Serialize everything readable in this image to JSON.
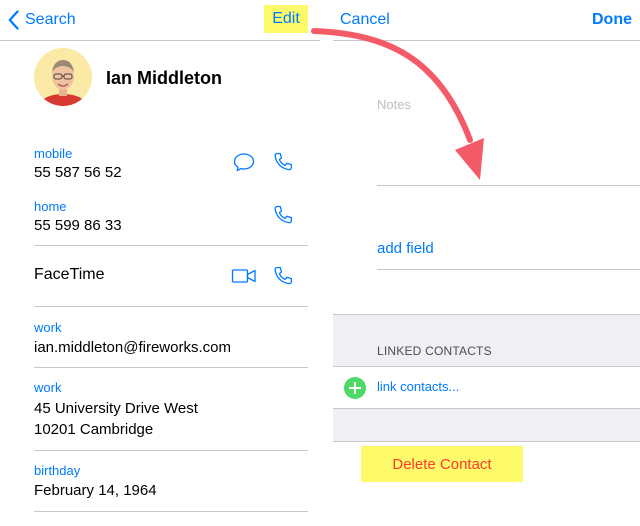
{
  "left": {
    "nav": {
      "back_label": "Search",
      "edit_label": "Edit"
    },
    "contact": {
      "name": "Ian Middleton"
    },
    "fields": {
      "mobile_label": "mobile",
      "mobile_value": "55 587 56 52",
      "home_label": "home",
      "home_value": "55 599 86 33",
      "facetime_label": "FaceTime",
      "work_email_label": "work",
      "work_email_value": "ian.middleton@fireworks.com",
      "work_address_label": "work",
      "work_address_line1": "45 University Drive West",
      "work_address_line2": "10201 Cambridge",
      "birthday_label": "birthday",
      "birthday_value": "February 14, 1964"
    }
  },
  "right": {
    "nav": {
      "cancel_label": "Cancel",
      "done_label": "Done"
    },
    "notes_placeholder": "Notes",
    "add_field_label": "add field",
    "linked_contacts_header": "LINKED CONTACTS",
    "link_contacts_label": "link contacts...",
    "delete_contact_label": "Delete Contact"
  },
  "colors": {
    "accent": "#007aff",
    "highlight": "#fdfb6a",
    "destructive": "#ff3b30",
    "add_green": "#4cd964",
    "annotation_arrow": "#f45b69",
    "group_background": "#efeff4"
  },
  "icons": {
    "back": "chevron-left-icon",
    "message": "message-bubble-icon",
    "phone": "phone-icon",
    "video": "video-camera-icon",
    "add": "plus-circle-icon"
  }
}
